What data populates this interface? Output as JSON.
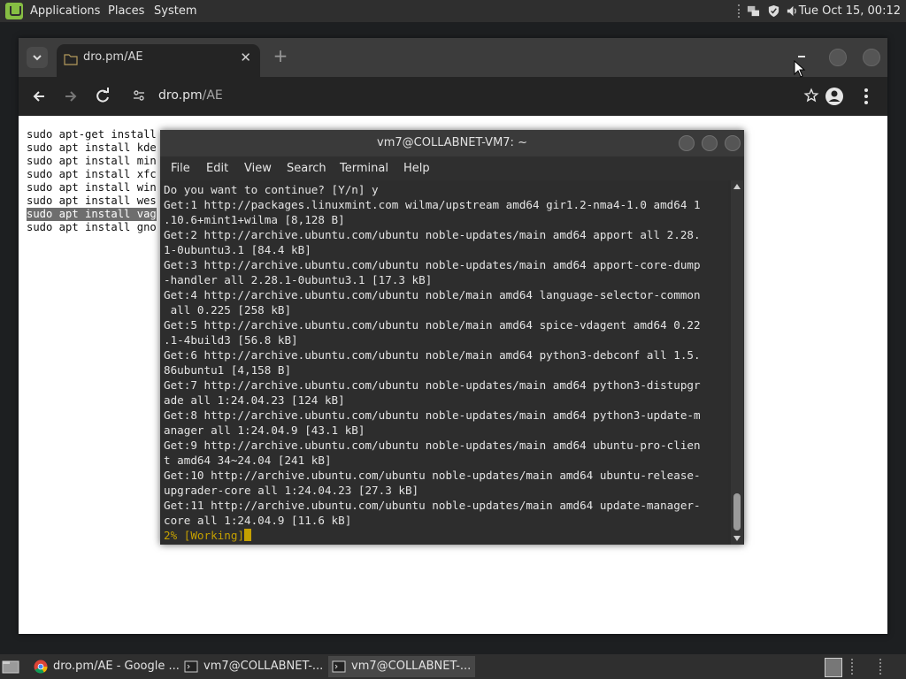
{
  "top_panel": {
    "menus": [
      "Applications",
      "Places",
      "System"
    ],
    "clock": "Tue Oct 15, 00:12",
    "tray_icons": [
      "network-icon",
      "shield-icon",
      "volume-icon"
    ]
  },
  "browser": {
    "tab": {
      "title": "dro.pm/AE",
      "icon": "document-icon"
    },
    "address": {
      "host": "dro.pm",
      "path": "/AE"
    },
    "page_lines": [
      "sudo apt-get install",
      "sudo apt install kde",
      "sudo apt install min",
      "sudo apt install xfc",
      "sudo apt install win",
      "sudo apt install wes",
      "sudo apt install vag",
      "sudo apt install gno"
    ],
    "selected_line_index": 6
  },
  "terminal": {
    "title": "vm7@COLLABNET-VM7: ~",
    "menu": [
      "File",
      "Edit",
      "View",
      "Search",
      "Terminal",
      "Help"
    ],
    "lines": [
      "Do you want to continue? [Y/n] y",
      "Get:1 http://packages.linuxmint.com wilma/upstream amd64 gir1.2-nma4-1.0 amd64 1",
      ".10.6+mint1+wilma [8,128 B]",
      "Get:2 http://archive.ubuntu.com/ubuntu noble-updates/main amd64 apport all 2.28.",
      "1-0ubuntu3.1 [84.4 kB]",
      "Get:3 http://archive.ubuntu.com/ubuntu noble-updates/main amd64 apport-core-dump",
      "-handler all 2.28.1-0ubuntu3.1 [17.3 kB]",
      "Get:4 http://archive.ubuntu.com/ubuntu noble/main amd64 language-selector-common",
      " all 0.225 [258 kB]",
      "Get:5 http://archive.ubuntu.com/ubuntu noble/main amd64 spice-vdagent amd64 0.22",
      ".1-4build3 [56.8 kB]",
      "Get:6 http://archive.ubuntu.com/ubuntu noble/main amd64 python3-debconf all 1.5.",
      "86ubuntu1 [4,158 B]",
      "Get:7 http://archive.ubuntu.com/ubuntu noble-updates/main amd64 python3-distupgr",
      "ade all 1:24.04.23 [124 kB]",
      "Get:8 http://archive.ubuntu.com/ubuntu noble-updates/main amd64 python3-update-m",
      "anager all 1:24.04.9 [43.1 kB]",
      "Get:9 http://archive.ubuntu.com/ubuntu noble-updates/main amd64 ubuntu-pro-clien",
      "t amd64 34~24.04 [241 kB]",
      "Get:10 http://archive.ubuntu.com/ubuntu noble-updates/main amd64 ubuntu-release-",
      "upgrader-core all 1:24.04.23 [27.3 kB]",
      "Get:11 http://archive.ubuntu.com/ubuntu noble-updates/main amd64 update-manager-",
      "core all 1:24.04.9 [11.6 kB]"
    ],
    "status_line": "2% [Working]"
  },
  "taskbar": {
    "tasks": [
      {
        "label": "dro.pm/AE - Google ...",
        "icon": "chrome-icon",
        "active": false
      },
      {
        "label": "vm7@COLLABNET-...",
        "icon": "terminal-icon",
        "active": false
      },
      {
        "label": "vm7@COLLABNET-...",
        "icon": "terminal-icon",
        "active": true
      }
    ]
  },
  "colors": {
    "mint_green": "#86be43",
    "terminal_status": "#c4a000",
    "panel_bg": "#2f2f2f"
  }
}
